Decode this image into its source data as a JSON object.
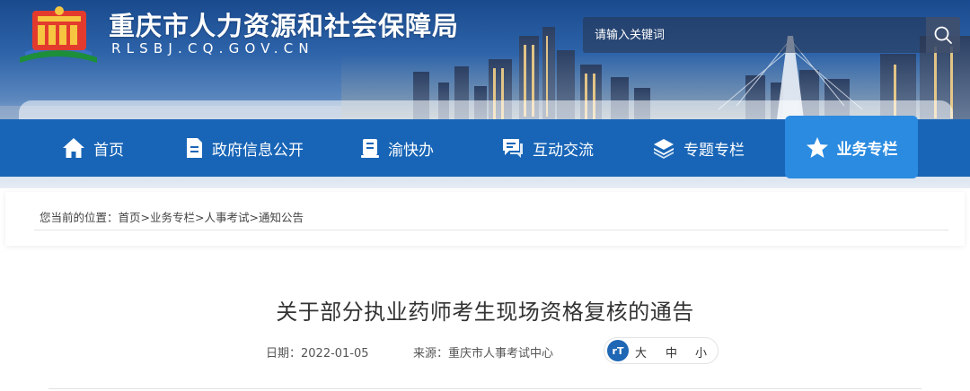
{
  "header": {
    "site_title": "重庆市人力资源和社会保障局",
    "site_domain": "RLSBJ.CQ.GOV.CN",
    "search": {
      "placeholder": "请输入关键词"
    }
  },
  "nav": {
    "items": [
      {
        "label": "首页",
        "icon": "home-icon"
      },
      {
        "label": "政府信息公开",
        "icon": "document-icon"
      },
      {
        "label": "渝快办",
        "icon": "id-card-icon"
      },
      {
        "label": "互动交流",
        "icon": "chat-icon"
      },
      {
        "label": "专题专栏",
        "icon": "layers-icon"
      },
      {
        "label": "业务专栏",
        "icon": "star-icon",
        "active": true
      }
    ]
  },
  "breadcrumb": {
    "prefix": "您当前的位置：",
    "items": [
      "首页",
      "业务专栏",
      "人事考试",
      "通知公告"
    ],
    "separator": ">"
  },
  "article": {
    "title": "关于部分执业药师考生现场资格复核的通告",
    "date_label": "日期：",
    "date": "2022-01-05",
    "source_label": "来源：",
    "source": "重庆市人事考试中心",
    "font_size": {
      "icon_text": "rT",
      "options": [
        "大",
        "中",
        "小"
      ]
    }
  },
  "colors": {
    "nav_bg": "#1865b7",
    "nav_active_bg": "#2b8be0",
    "text_dark": "#333333"
  }
}
